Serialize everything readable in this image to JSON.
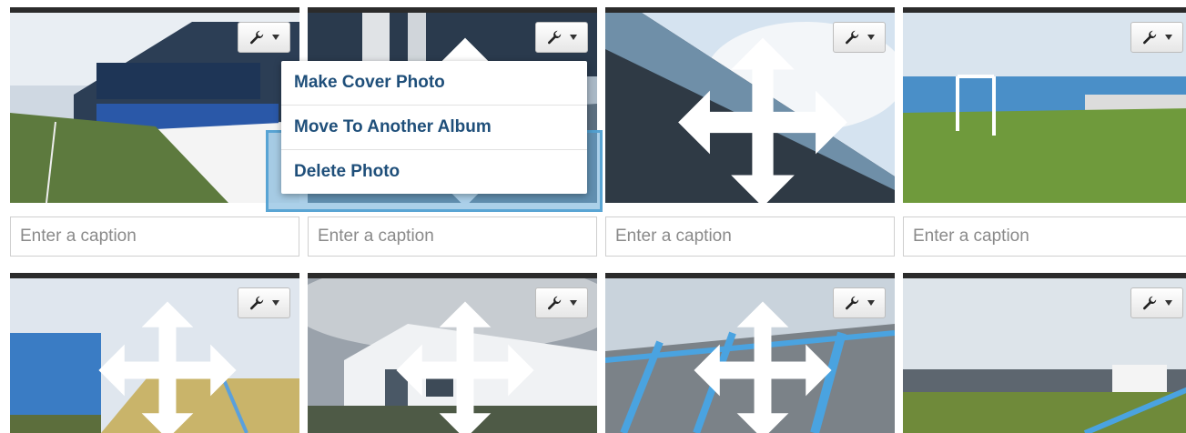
{
  "caption_placeholder": "Enter a caption",
  "menu": {
    "items": [
      {
        "label": "Make Cover Photo"
      },
      {
        "label": "Move To Another Album"
      },
      {
        "label": "Delete Photo"
      }
    ]
  },
  "photos": [
    {
      "subject": "Stadium stand with blue seats"
    },
    {
      "subject": "Stand roof"
    },
    {
      "subject": "Underside of stand roof"
    },
    {
      "subject": "Goalmouth and blue terrace"
    },
    {
      "subject": "Blue portacabins and terrace steps"
    },
    {
      "subject": "White clubhouse building"
    },
    {
      "subject": "Blue crush barriers on terrace"
    },
    {
      "subject": "Wide view of pitch"
    }
  ],
  "colors": {
    "link_text": "#1f4f7a",
    "drop_highlight": "#66aad7"
  },
  "icons": {
    "tools": "wrench-icon",
    "move": "move-icon"
  }
}
